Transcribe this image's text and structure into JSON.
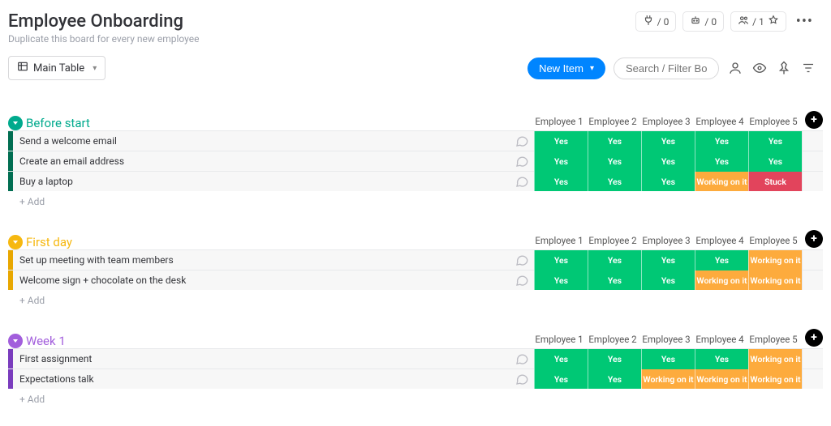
{
  "header": {
    "title": "Employee Onboarding",
    "subtitle": "Duplicate this board for every new employee",
    "integrations_count": "/ 0",
    "automations_count": "/ 0",
    "members_count": "/ 1"
  },
  "toolbar": {
    "view_name": "Main Table",
    "new_item_label": "New Item",
    "search_placeholder": "Search / Filter Board"
  },
  "columns": [
    "Employee 1",
    "Employee 2",
    "Employee 3",
    "Employee 4",
    "Employee 5"
  ],
  "status_styles": {
    "Yes": "c-yes",
    "Working on it": "c-working",
    "Stuck": "c-stuck"
  },
  "add_row_label": "+ Add",
  "groups": [
    {
      "name": "Before start",
      "color": "#00aa8d",
      "strip": "#016e52",
      "rows": [
        {
          "name": "Send a welcome email",
          "values": [
            "Yes",
            "Yes",
            "Yes",
            "Yes",
            "Yes"
          ]
        },
        {
          "name": "Create an email address",
          "values": [
            "Yes",
            "Yes",
            "Yes",
            "Yes",
            "Yes"
          ]
        },
        {
          "name": "Buy a laptop",
          "values": [
            "Yes",
            "Yes",
            "Yes",
            "Working on it",
            "Stuck"
          ]
        }
      ]
    },
    {
      "name": "First day",
      "color": "#f6b810",
      "strip": "#e8a700",
      "rows": [
        {
          "name": "Set up meeting with team members",
          "values": [
            "Yes",
            "Yes",
            "Yes",
            "Yes",
            "Working on it"
          ]
        },
        {
          "name": "Welcome sign + chocolate on the desk",
          "values": [
            "Yes",
            "Yes",
            "Yes",
            "Working on it",
            "Working on it"
          ]
        }
      ]
    },
    {
      "name": "Week 1",
      "color": "#a25edc",
      "strip": "#7a3cbd",
      "rows": [
        {
          "name": "First assignment",
          "values": [
            "Yes",
            "Yes",
            "Yes",
            "Yes",
            "Working on it"
          ]
        },
        {
          "name": "Expectations talk",
          "values": [
            "Yes",
            "Yes",
            "Working on it",
            "Working on it",
            "Working on it"
          ]
        }
      ]
    }
  ]
}
